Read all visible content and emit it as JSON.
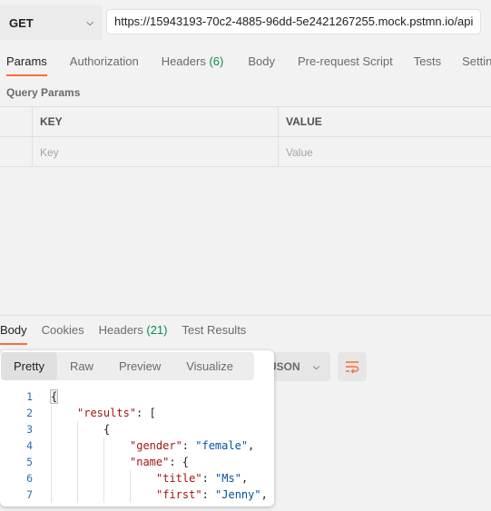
{
  "request": {
    "method": "GET",
    "url": "https://15943193-70c2-4885-96dd-5e2421267255.mock.pstmn.io/api"
  },
  "request_tabs": [
    {
      "label": "Params",
      "count": "",
      "active": true
    },
    {
      "label": "Authorization",
      "count": "",
      "active": false
    },
    {
      "label": "Headers",
      "count": "(6)",
      "active": false
    },
    {
      "label": "Body",
      "count": "",
      "active": false
    },
    {
      "label": "Pre-request Script",
      "count": "",
      "active": false
    },
    {
      "label": "Tests",
      "count": "",
      "active": false
    },
    {
      "label": "Settings",
      "count": "",
      "active": false
    }
  ],
  "query_params": {
    "title": "Query Params",
    "key_header": "KEY",
    "value_header": "VALUE",
    "key_placeholder": "Key",
    "value_placeholder": "Value"
  },
  "response_tabs": [
    {
      "label": "Body",
      "count": "",
      "active": true
    },
    {
      "label": "Cookies",
      "count": "",
      "active": false
    },
    {
      "label": "Headers",
      "count": "(21)",
      "active": false
    },
    {
      "label": "Test Results",
      "count": "",
      "active": false
    }
  ],
  "view_modes": [
    "Pretty",
    "Raw",
    "Preview",
    "Visualize"
  ],
  "active_view": "Pretty",
  "format": "JSON",
  "icons": {
    "wrap": "wrap-lines-icon",
    "chevron": "chevron-down-icon"
  },
  "colors": {
    "accent": "#ff6c37",
    "count": "#0b8a4e",
    "json_key": "#a31515",
    "json_string": "#0451a5"
  },
  "code_lines": [
    {
      "n": "1",
      "indent": 0,
      "parts": [
        {
          "t": "{",
          "c": "brace"
        }
      ]
    },
    {
      "n": "2",
      "indent": 1,
      "parts": [
        {
          "t": "\"results\"",
          "c": "k"
        },
        {
          "t": ": [",
          "c": ""
        }
      ]
    },
    {
      "n": "3",
      "indent": 2,
      "parts": [
        {
          "t": "{",
          "c": ""
        }
      ]
    },
    {
      "n": "4",
      "indent": 3,
      "parts": [
        {
          "t": "\"gender\"",
          "c": "k"
        },
        {
          "t": ": ",
          "c": ""
        },
        {
          "t": "\"female\"",
          "c": "s"
        },
        {
          "t": ",",
          "c": ""
        }
      ]
    },
    {
      "n": "5",
      "indent": 3,
      "parts": [
        {
          "t": "\"name\"",
          "c": "k"
        },
        {
          "t": ": {",
          "c": ""
        }
      ]
    },
    {
      "n": "6",
      "indent": 4,
      "parts": [
        {
          "t": "\"title\"",
          "c": "k"
        },
        {
          "t": ": ",
          "c": ""
        },
        {
          "t": "\"Ms\"",
          "c": "s"
        },
        {
          "t": ",",
          "c": ""
        }
      ]
    },
    {
      "n": "7",
      "indent": 4,
      "parts": [
        {
          "t": "\"first\"",
          "c": "k"
        },
        {
          "t": ": ",
          "c": ""
        },
        {
          "t": "\"Jenny\"",
          "c": "s"
        },
        {
          "t": ",",
          "c": ""
        }
      ]
    }
  ]
}
